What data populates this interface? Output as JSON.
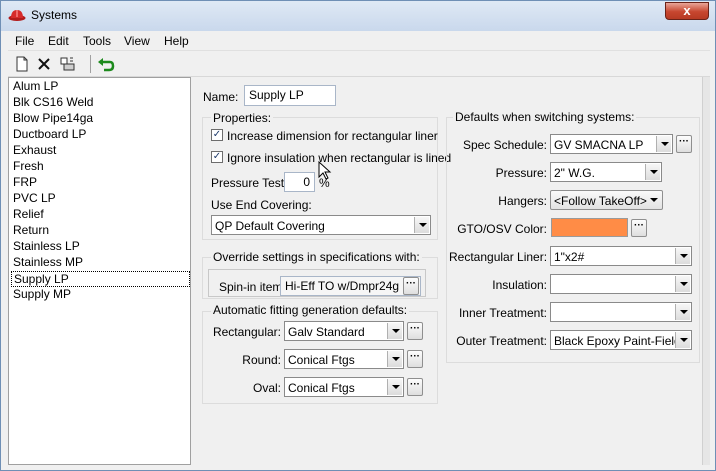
{
  "window": {
    "title": "Systems",
    "close_label": "x"
  },
  "menu": [
    "File",
    "Edit",
    "Tools",
    "View",
    "Help"
  ],
  "toolbar": {
    "new_icon": "new-document-icon",
    "delete_icon": "delete-x-icon",
    "properties_icon": "properties-icon",
    "undo_icon": "undo-green-arrow-icon"
  },
  "systems": [
    "Alum LP",
    "Blk CS16 Weld",
    "Blow Pipe14ga",
    "Ductboard LP",
    "Exhaust",
    "Fresh",
    "FRP",
    "PVC LP",
    "Relief",
    "Return",
    "Stainless LP",
    "Stainless MP",
    "Supply LP",
    "Supply MP"
  ],
  "selected_system": "Supply LP",
  "form": {
    "name_label": "Name:",
    "name_value": "Supply LP",
    "properties_title": "Properties:",
    "increase_dimension_label": "Increase dimension for rectangular liner",
    "increase_dimension_checked": true,
    "ignore_insulation_label": "Ignore insulation when rectangular is lined",
    "ignore_insulation_checked": true,
    "pressure_test_label": "Pressure Test:",
    "pressure_test_value": "0",
    "pressure_test_unit": "%",
    "use_end_covering_label": "Use End Covering:",
    "use_end_covering_value": "QP Default Covering",
    "override_title": "Override settings in specifications with:",
    "spin_in_label": "Spin-in item:",
    "spin_in_value": "Hi-Eff TO w/Dmpr24g",
    "auto_fitting_title": "Automatic fitting generation defaults:",
    "rectangular_label": "Rectangular:",
    "rectangular_value": "Galv Standard",
    "round_label": "Round:",
    "round_value": "Conical Ftgs",
    "oval_label": "Oval:",
    "oval_value": "Conical Ftgs"
  },
  "defaults": {
    "title": "Defaults when switching systems:",
    "spec_schedule_label": "Spec Schedule:",
    "spec_schedule_value": "GV SMACNA  LP",
    "pressure_label": "Pressure:",
    "pressure_value": "2\" W.G.",
    "hangers_label": "Hangers:",
    "hangers_value": "<Follow TakeOff>",
    "gto_color_label": "GTO/OSV Color:",
    "gto_color_hex": "#ff8c46",
    "rect_liner_label": "Rectangular Liner:",
    "rect_liner_value": "1\"x2#",
    "insulation_label": "Insulation:",
    "insulation_value": "",
    "inner_treatment_label": "Inner Treatment:",
    "inner_treatment_value": "",
    "outer_treatment_label": "Outer Treatment:",
    "outer_treatment_value": "Black Epoxy Paint-Field"
  },
  "ellipsis_label": "···"
}
